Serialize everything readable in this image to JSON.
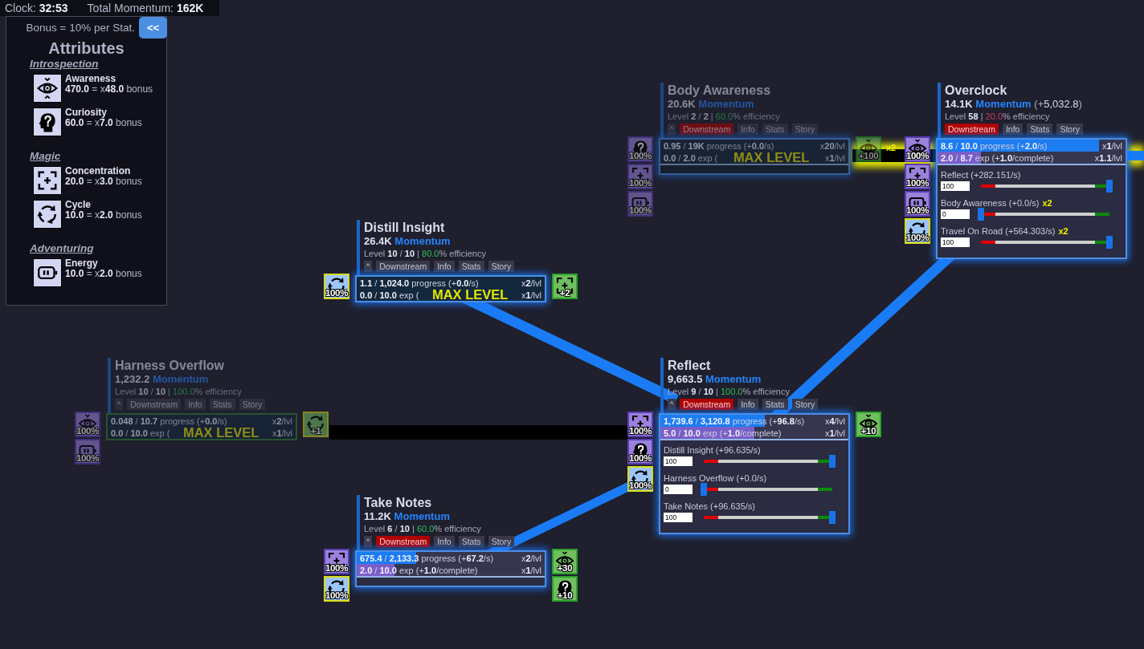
{
  "top_bar": {
    "clock_label": "Clock:",
    "clock": "32:53",
    "momentum_label": "Total Momentum:",
    "momentum": "162K"
  },
  "attributes": {
    "note": "Bonus = 10% per Stat.",
    "collapse_button": "<<",
    "title": "Attributes",
    "groups": [
      {
        "name": "Introspection",
        "items": [
          {
            "kind": "awareness",
            "name": "Awareness",
            "value": "**470.0** = x**48.0** bonus"
          },
          {
            "kind": "curiosity",
            "name": "Curiosity",
            "value": "**60.0** = x**7.0** bonus"
          }
        ]
      },
      {
        "name": "Magic",
        "items": [
          {
            "kind": "concentration",
            "name": "Concentration",
            "value": "**20.0** = x**3.0** bonus"
          },
          {
            "kind": "cycle",
            "name": "Cycle",
            "value": "**10.0** = x**2.0** bonus"
          }
        ]
      },
      {
        "name": "Adventuring",
        "items": [
          {
            "kind": "energy",
            "name": "Energy",
            "value": "**10.0** = x**2.0** bonus"
          }
        ]
      }
    ]
  },
  "links": [
    {
      "active": false,
      "boosted": true,
      "label": "x2"
    },
    {
      "active": true,
      "boosted": true
    },
    {
      "active": true,
      "boosted": false
    },
    {
      "active": true,
      "boosted": false
    },
    {
      "active": false,
      "boosted": false
    },
    {
      "active": true,
      "boosted": false
    }
  ],
  "nodes": [
    {
      "title": "Body Awareness",
      "faded": true,
      "glow": true,
      "momentum": {
        "value": "20.6K",
        "unit": "Momentum"
      },
      "level": "Level **2** / **2** |",
      "efficiency": "60.0",
      "efficiency_low": false,
      "efficiency_unit": "% efficiency",
      "toggle": "^",
      "tabs": [
        {
          "label": "Downstream",
          "selected": true
        },
        {
          "label": "Info",
          "selected": false
        },
        {
          "label": "Stats",
          "selected": false
        },
        {
          "label": "Story",
          "selected": false
        }
      ],
      "progress": {
        "text": "**0.95** / **19K** progress (+**0.0**/s)",
        "multiplier": "x**20**/lvl"
      },
      "exp": {
        "text": "**0.0** / **2.0** exp (",
        "multiplier": "x**1**/lvl"
      },
      "max_label": "MAX LEVEL",
      "inputs": [
        {
          "kind": "curiosity",
          "value": "100%",
          "highlighted": false
        },
        {
          "kind": "concentration",
          "value": "100%",
          "highlighted": false
        },
        {
          "kind": "energy",
          "value": "100%",
          "highlighted": false
        }
      ],
      "outputs": [
        {
          "kind": "awareness",
          "value": "+100",
          "highlighted": false
        }
      ]
    },
    {
      "title": "Overclock",
      "faded": false,
      "glow": true,
      "momentum": {
        "value": "14.1K",
        "unit": "Momentum",
        "rate": "(+**5,032.8**)"
      },
      "level": "Level **58** |",
      "efficiency": "20.0",
      "efficiency_low": true,
      "efficiency_unit": "% efficiency",
      "tabs": [
        {
          "label": "Downstream",
          "selected": true
        },
        {
          "label": "Info",
          "selected": false
        },
        {
          "label": "Stats",
          "selected": false
        },
        {
          "label": "Story",
          "selected": false
        }
      ],
      "progress": {
        "text": "**8.6** / **10.0** progress (+**2.0**/s)",
        "multiplier": "x**1**/lvl",
        "level": 0.86
      },
      "exp": {
        "text": "**2.0** / **8.7** exp (+**1.0**/complete)",
        "multiplier": "x**1.1**/lvl",
        "level": 0.23
      },
      "sliders": [
        {
          "label": "Reflect (+282.151/s)",
          "value": "100",
          "level": 1
        },
        {
          "label": "Body Awareness (+0.0/s)",
          "bonus": "x2",
          "value": "0",
          "level": 0
        },
        {
          "label": "Travel On Road (+564.303/s)",
          "bonus": "x2",
          "value": "100",
          "level": 1
        }
      ],
      "inputs": [
        {
          "kind": "awareness",
          "value": "100%",
          "highlighted": false
        },
        {
          "kind": "concentration",
          "value": "100%",
          "highlighted": false
        },
        {
          "kind": "energy",
          "value": "100%",
          "highlighted": false
        },
        {
          "kind": "cycle",
          "value": "100%",
          "highlighted": true
        }
      ]
    },
    {
      "title": "Distill Insight",
      "faded": false,
      "glow": true,
      "momentum": {
        "value": "26.4K",
        "unit": "Momentum"
      },
      "level": "Level **10** / **10** |",
      "efficiency": "80.0",
      "efficiency_low": false,
      "efficiency_unit": "% efficiency",
      "toggle": "^",
      "tabs": [
        {
          "label": "Downstream",
          "selected": false
        },
        {
          "label": "Info",
          "selected": false
        },
        {
          "label": "Stats",
          "selected": false
        },
        {
          "label": "Story",
          "selected": false
        }
      ],
      "progress": {
        "text": "**1.1** / **1,024.0** progress (+**0.0**/s)",
        "multiplier": "x**2**/lvl"
      },
      "exp": {
        "text": "**0.0** / **10.0** exp (",
        "multiplier": "x**1**/lvl"
      },
      "max_label": "MAX LEVEL",
      "inputs": [
        {
          "kind": "cycle",
          "value": "100%",
          "highlighted": true
        }
      ],
      "outputs": [
        {
          "kind": "concentration",
          "value": "+2",
          "highlighted": false
        }
      ]
    },
    {
      "title": "Harness Overflow",
      "faded": true,
      "glow": false,
      "momentum": {
        "value": "1,232.2",
        "unit": "Momentum"
      },
      "level": "Level **10** / **10** |",
      "efficiency": "100.0",
      "efficiency_low": false,
      "efficiency_unit": "% efficiency",
      "toggle": "^",
      "tabs": [
        {
          "label": "Downstream",
          "selected": false
        },
        {
          "label": "Info",
          "selected": false
        },
        {
          "label": "Stats",
          "selected": false
        },
        {
          "label": "Story",
          "selected": false
        }
      ],
      "progress": {
        "text": "**0.048** / **10.7** progress (+**0.0**/s)",
        "multiplier": "x**2**/lvl"
      },
      "exp": {
        "text": "**0.0** / **10.0** exp (",
        "multiplier": "x**1**/lvl"
      },
      "max_label": "MAX LEVEL",
      "inputs": [
        {
          "kind": "awareness",
          "value": "100%",
          "highlighted": false
        },
        {
          "kind": "energy",
          "value": "100%",
          "highlighted": false
        }
      ],
      "outputs": [
        {
          "kind": "cycle",
          "value": "+1",
          "highlighted": true
        }
      ]
    },
    {
      "title": "Reflect",
      "faded": false,
      "glow": true,
      "momentum": {
        "value": "9,663.5",
        "unit": "Momentum"
      },
      "level": "Level **9** / **10** |",
      "efficiency": "100.0",
      "efficiency_low": false,
      "efficiency_unit": "% efficiency",
      "toggle": "^",
      "tabs": [
        {
          "label": "Downstream",
          "selected": true
        },
        {
          "label": "Info",
          "selected": false
        },
        {
          "label": "Stats",
          "selected": false
        },
        {
          "label": "Story",
          "selected": false
        }
      ],
      "progress": {
        "text": "**1,739.6** / **3,120.8** progress (+**96.8**/s)",
        "multiplier": "x**4**/lvl",
        "level": 0.557
      },
      "exp": {
        "text": "**5.0** / **10.0** exp (+**1.0**/complete)",
        "multiplier": "x**1**/lvl",
        "level": 0.5
      },
      "sliders": [
        {
          "label": "Distill Insight (+96.635/s)",
          "value": "100",
          "level": 1
        },
        {
          "label": "Harness Overflow (+0.0/s)",
          "value": "0",
          "level": 0
        },
        {
          "label": "Take Notes (+96.635/s)",
          "value": "100",
          "level": 1
        }
      ],
      "inputs": [
        {
          "kind": "concentration",
          "value": "100%",
          "highlighted": false
        },
        {
          "kind": "curiosity",
          "value": "100%",
          "highlighted": false
        },
        {
          "kind": "cycle",
          "value": "100%",
          "highlighted": true
        }
      ],
      "outputs": [
        {
          "kind": "awareness",
          "value": "+10",
          "highlighted": false
        }
      ]
    },
    {
      "title": "Take Notes",
      "faded": false,
      "glow": true,
      "momentum": {
        "value": "11.2K",
        "unit": "Momentum"
      },
      "level": "Level **6** / **10** |",
      "efficiency": "60.0",
      "efficiency_low": false,
      "efficiency_unit": "% efficiency",
      "toggle": "^",
      "tabs": [
        {
          "label": "Downstream",
          "selected": true
        },
        {
          "label": "Info",
          "selected": false
        },
        {
          "label": "Stats",
          "selected": false
        },
        {
          "label": "Story",
          "selected": false
        }
      ],
      "progress": {
        "text": "**675.4** / **2,133.3** progress (+**67.2**/s)",
        "multiplier": "x**2**/lvl",
        "level": 0.317
      },
      "exp": {
        "text": "**2.0** / **10.0** exp (+**1.0**/complete)",
        "multiplier": "x**1**/lvl",
        "level": 0.2
      },
      "inputs": [
        {
          "kind": "concentration",
          "value": "100%",
          "highlighted": false
        },
        {
          "kind": "cycle",
          "value": "100%",
          "highlighted": true
        }
      ],
      "outputs": [
        {
          "kind": "awareness",
          "value": "+30",
          "highlighted": false
        },
        {
          "kind": "curiosity",
          "value": "+10",
          "highlighted": false
        }
      ]
    }
  ]
}
